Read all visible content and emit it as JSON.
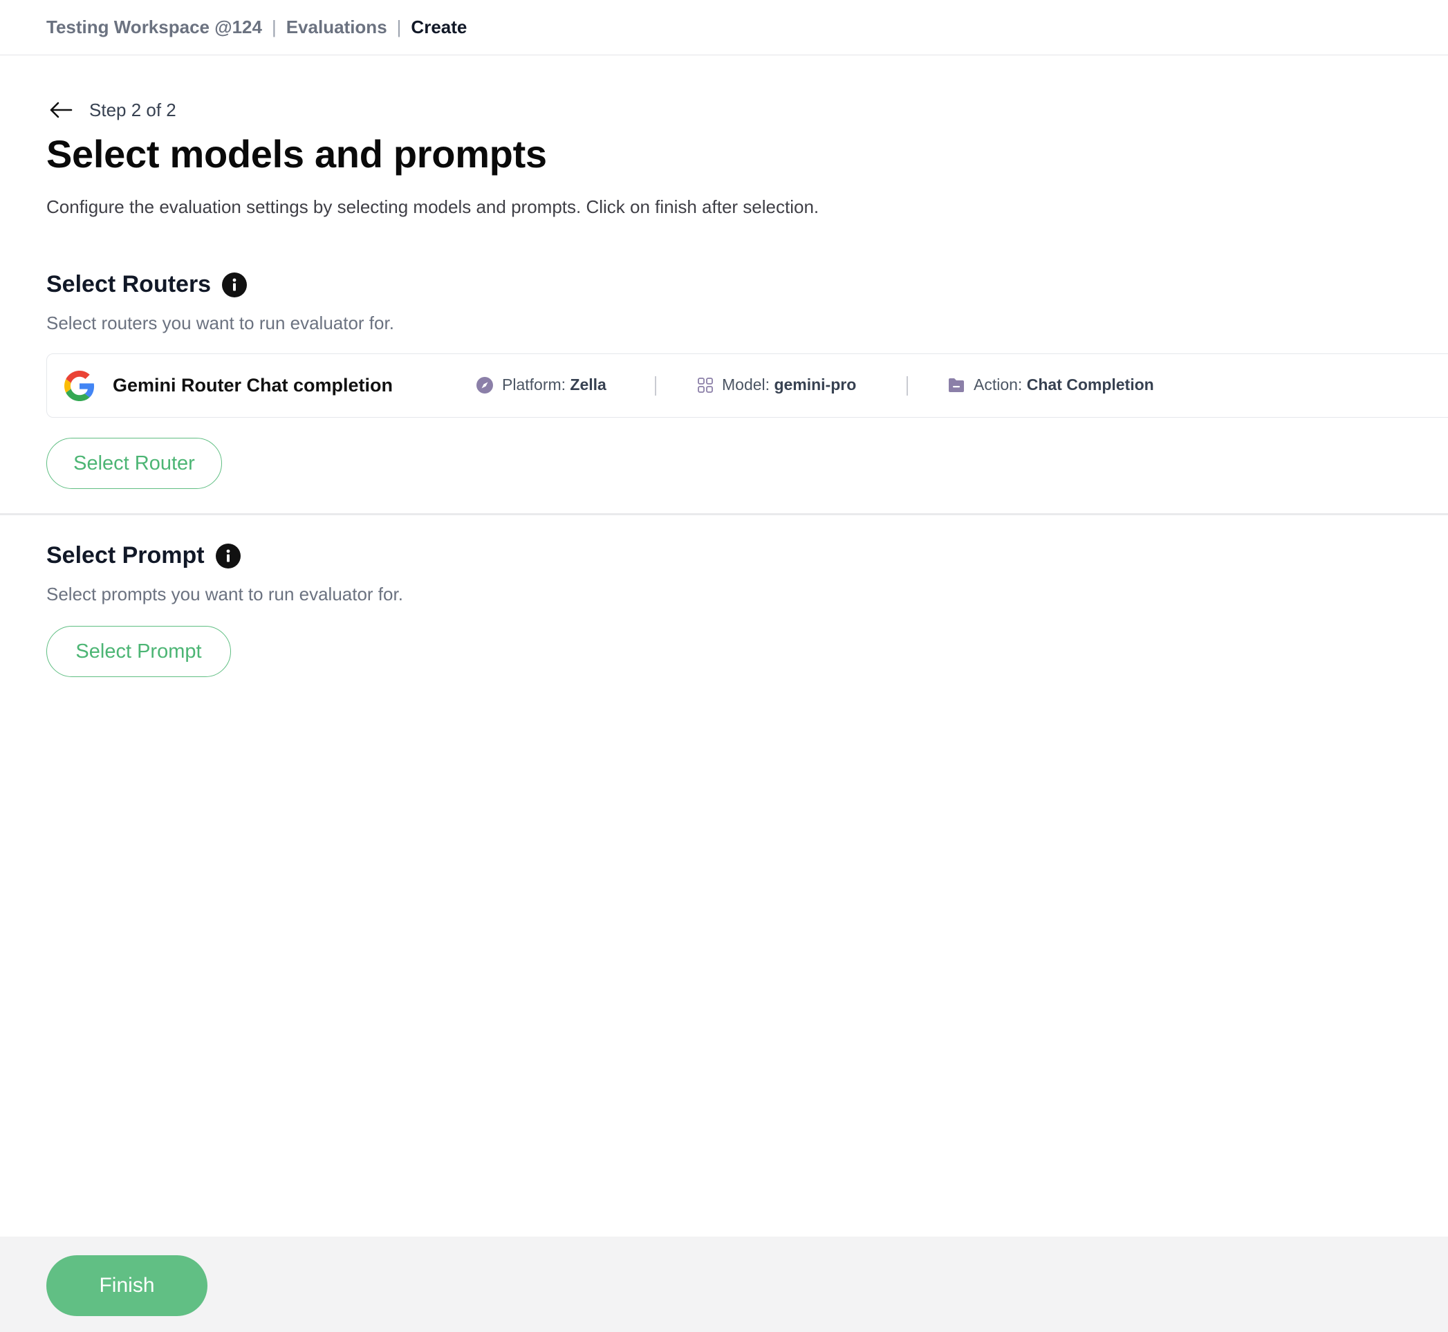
{
  "breadcrumb": {
    "workspace": "Testing Workspace @124",
    "section": "Evaluations",
    "current": "Create",
    "separator": "|"
  },
  "step": {
    "label": "Step 2 of 2",
    "back_icon": "arrow-left-icon"
  },
  "page": {
    "title": "Select models and prompts",
    "description": "Configure the evaluation settings by selecting models and prompts. Click on finish after selection."
  },
  "routers_section": {
    "heading": "Select Routers",
    "subtitle": "Select routers you want to run evaluator for.",
    "info_icon": "info-icon",
    "router": {
      "icon": "google-logo",
      "name": "Gemini Router Chat completion",
      "platform_label": "Platform:",
      "platform_value": "Zella",
      "platform_icon": "compass-icon",
      "model_label": "Model:",
      "model_value": "gemini-pro",
      "model_icon": "grid-icon",
      "action_label": "Action:",
      "action_value": "Chat Completion",
      "action_icon": "folder-icon"
    },
    "button_label": "Select Router"
  },
  "prompt_section": {
    "heading": "Select Prompt",
    "subtitle": "Select prompts you want to run evaluator for.",
    "info_icon": "info-icon",
    "button_label": "Select Prompt"
  },
  "footer": {
    "finish_label": "Finish"
  },
  "colors": {
    "accent_green": "#61bf84",
    "outline_green": "#4cb574",
    "meta_icon_purple": "#8b7fa8"
  }
}
